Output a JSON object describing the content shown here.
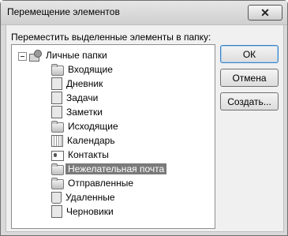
{
  "window": {
    "title": "Перемещение элементов",
    "close_label": "✕"
  },
  "prompt": "Переместить выделенные элементы в папку:",
  "buttons": {
    "ok": "ОК",
    "cancel": "Отмена",
    "create": "Создать..."
  },
  "tree": {
    "root": {
      "label": "Личные папки",
      "icon": "personal-folders-icon",
      "expanded": true
    },
    "items": [
      {
        "label": "Входящие",
        "icon": "inbox-folder-icon"
      },
      {
        "label": "Дневник",
        "icon": "journal-icon"
      },
      {
        "label": "Задачи",
        "icon": "tasks-icon"
      },
      {
        "label": "Заметки",
        "icon": "notes-icon"
      },
      {
        "label": "Исходящие",
        "icon": "outbox-folder-icon"
      },
      {
        "label": "Календарь",
        "icon": "calendar-icon"
      },
      {
        "label": "Контакты",
        "icon": "contacts-icon"
      },
      {
        "label": "Нежелательная почта",
        "icon": "junk-mail-folder-icon",
        "selected": true
      },
      {
        "label": "Отправленные",
        "icon": "sent-folder-icon"
      },
      {
        "label": "Удаленные",
        "icon": "deleted-items-icon"
      },
      {
        "label": "Черновики",
        "icon": "drafts-icon"
      }
    ]
  }
}
